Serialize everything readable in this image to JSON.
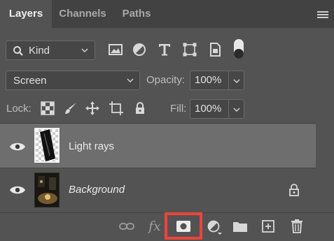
{
  "tabs": [
    {
      "label": "Layers",
      "active": true
    },
    {
      "label": "Channels",
      "active": false
    },
    {
      "label": "Paths",
      "active": false
    }
  ],
  "filter": {
    "kind_label": "Kind",
    "icons": [
      "image-filter-icon",
      "adjustment-filter-icon",
      "type-filter-icon",
      "shape-filter-icon",
      "smart-object-filter-icon"
    ]
  },
  "blend": {
    "mode": "Screen",
    "opacity_label": "Opacity:",
    "opacity_value": "100%"
  },
  "lock": {
    "label": "Lock:",
    "fill_label": "Fill:",
    "fill_value": "100%"
  },
  "layers": [
    {
      "name": "Light rays",
      "selected": true,
      "italic": false,
      "locked": false
    },
    {
      "name": "Background",
      "selected": false,
      "italic": true,
      "locked": true
    }
  ],
  "bottom": {
    "fx_label": "fx",
    "highlight_color": "#f0433a"
  }
}
